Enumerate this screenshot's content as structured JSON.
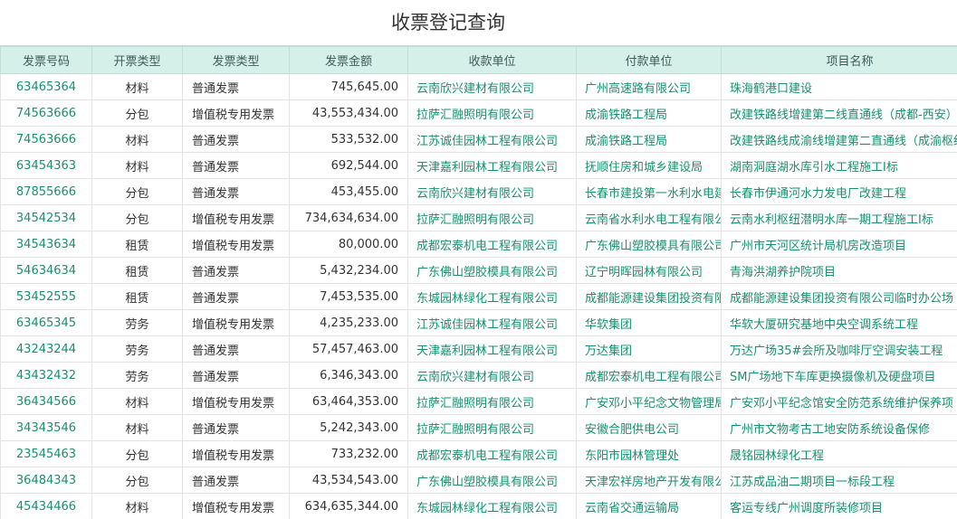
{
  "page": {
    "title": "收票登记查询"
  },
  "table": {
    "columns": [
      "发票号码",
      "开票类型",
      "发票类型",
      "发票金额",
      "收款单位",
      "付款单位",
      "项目名称"
    ],
    "rows": [
      {
        "no": "63465364",
        "bill_type": "材料",
        "invoice_type": "普通发票",
        "amount": "745,645.00",
        "payee": "云南欣兴建材有限公司",
        "payer": "广州高速路有限公司",
        "project": "珠海鹤港口建设"
      },
      {
        "no": "74563666",
        "bill_type": "分包",
        "invoice_type": "增值税专用发票",
        "amount": "43,553,434.00",
        "payee": "拉萨汇融照明有限公司",
        "payer": "成渝铁路工程局",
        "project": "改建铁路线增建第二线直通线（成都-西安）"
      },
      {
        "no": "74563666",
        "bill_type": "材料",
        "invoice_type": "普通发票",
        "amount": "533,532.00",
        "payee": "江苏诚佳园林工程有限公司",
        "payer": "成渝铁路工程局",
        "project": "改建铁路线成渝线增建第二直通线（成渝枢纽"
      },
      {
        "no": "63454363",
        "bill_type": "材料",
        "invoice_type": "普通发票",
        "amount": "692,544.00",
        "payee": "天津嘉利园林工程有限公司",
        "payer": "抚顺住房和城乡建设局",
        "project": "湖南洞庭湖水库引水工程施工I标"
      },
      {
        "no": "87855666",
        "bill_type": "分包",
        "invoice_type": "普通发票",
        "amount": "453,455.00",
        "payee": "云南欣兴建材有限公司",
        "payer": "长春市建投第一水利水电建",
        "project": "长春市伊通河水力发电厂改建工程"
      },
      {
        "no": "34542534",
        "bill_type": "分包",
        "invoice_type": "增值税专用发票",
        "amount": "734,634,634.00",
        "payee": "拉萨汇融照明有限公司",
        "payer": "云南省水利水电工程有限公",
        "project": "云南水利枢纽潜明水库一期工程施工I标"
      },
      {
        "no": "34543634",
        "bill_type": "租赁",
        "invoice_type": "增值税专用发票",
        "amount": "80,000.00",
        "payee": "成都宏泰机电工程有限公司",
        "payer": "广东佛山塑胶模具有限公司",
        "project": "广州市天河区统计局机房改造项目"
      },
      {
        "no": "54634634",
        "bill_type": "租赁",
        "invoice_type": "普通发票",
        "amount": "5,432,234.00",
        "payee": "广东佛山塑胶模具有限公司",
        "payer": "辽宁明晖园林有限公司",
        "project": "青海洪湖养护院项目"
      },
      {
        "no": "53452555",
        "bill_type": "租赁",
        "invoice_type": "普通发票",
        "amount": "7,453,535.00",
        "payee": "东城园林绿化工程有限公司",
        "payer": "成都能源建设集团投资有限",
        "project": "成都能源建设集团投资有限公司临时办公场"
      },
      {
        "no": "63465345",
        "bill_type": "劳务",
        "invoice_type": "增值税专用发票",
        "amount": "4,235,233.00",
        "payee": "江苏诚佳园林工程有限公司",
        "payer": "华软集团",
        "project": "华软大厦研究基地中央空调系统工程"
      },
      {
        "no": "43243244",
        "bill_type": "劳务",
        "invoice_type": "普通发票",
        "amount": "57,457,463.00",
        "payee": "天津嘉利园林工程有限公司",
        "payer": "万达集团",
        "project": "万达广场35#会所及咖啡厅空调安装工程"
      },
      {
        "no": "43432432",
        "bill_type": "劳务",
        "invoice_type": "普通发票",
        "amount": "6,346,343.00",
        "payee": "云南欣兴建材有限公司",
        "payer": "成都宏泰机电工程有限公司",
        "project": "SM广场地下车库更换摄像机及硬盘项目"
      },
      {
        "no": "36434566",
        "bill_type": "材料",
        "invoice_type": "增值税专用发票",
        "amount": "63,464,353.00",
        "payee": "拉萨汇融照明有限公司",
        "payer": "广安邓小平纪念文物管理局",
        "project": "广安邓小平纪念馆安全防范系统维护保养项"
      },
      {
        "no": "34343546",
        "bill_type": "材料",
        "invoice_type": "普通发票",
        "amount": "5,242,343.00",
        "payee": "拉萨汇融照明有限公司",
        "payer": "安徽合肥供电公司",
        "project": "广州市文物考古工地安防系统设备保修"
      },
      {
        "no": "23545463",
        "bill_type": "分包",
        "invoice_type": "增值税专用发票",
        "amount": "733,232.00",
        "payee": "成都宏泰机电工程有限公司",
        "payer": "东阳市园林管理处",
        "project": "晟铭园林绿化工程"
      },
      {
        "no": "36484343",
        "bill_type": "分包",
        "invoice_type": "普通发票",
        "amount": "43,534,543.00",
        "payee": "广东佛山塑胶模具有限公司",
        "payer": "天津宏祥房地产开发有限公",
        "project": "江苏成品油二期项目一标段工程"
      },
      {
        "no": "45434466",
        "bill_type": "材料",
        "invoice_type": "增值税专用发票",
        "amount": "634,635,344.00",
        "payee": "东城园林绿化工程有限公司",
        "payer": "云南省交通运输局",
        "project": "客运专线广州调度所装修项目"
      }
    ]
  }
}
